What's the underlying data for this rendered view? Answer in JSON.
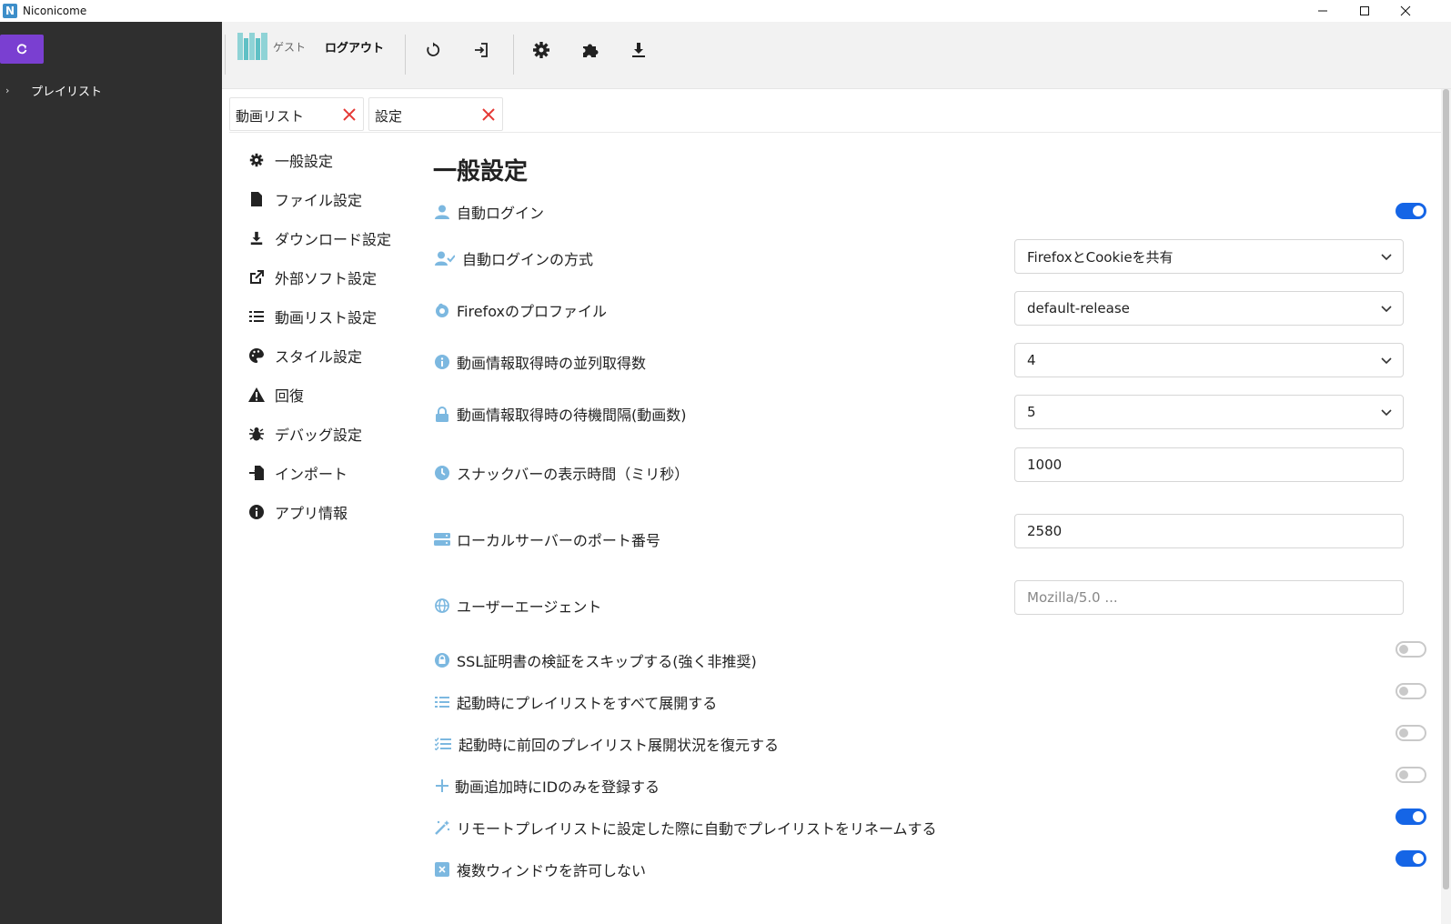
{
  "window": {
    "title": "Niconicome",
    "icon_letter": "N"
  },
  "sidebar": {
    "tree": [
      {
        "label": "プレイリスト"
      }
    ]
  },
  "toolbar": {
    "guest_label": "ゲスト",
    "logout_label": "ログアウト"
  },
  "tabs": [
    {
      "label": "動画リスト"
    },
    {
      "label": "設定"
    }
  ],
  "settings_nav": [
    {
      "label": "一般設定",
      "icon": "gear-icon"
    },
    {
      "label": "ファイル設定",
      "icon": "file-icon"
    },
    {
      "label": "ダウンロード設定",
      "icon": "download-icon"
    },
    {
      "label": "外部ソフト設定",
      "icon": "external-link-icon"
    },
    {
      "label": "動画リスト設定",
      "icon": "list-icon"
    },
    {
      "label": "スタイル設定",
      "icon": "palette-icon"
    },
    {
      "label": "回復",
      "icon": "warning-icon"
    },
    {
      "label": "デバッグ設定",
      "icon": "bug-icon"
    },
    {
      "label": "インポート",
      "icon": "import-icon"
    },
    {
      "label": "アプリ情報",
      "icon": "info-icon"
    }
  ],
  "general": {
    "heading": "一般設定",
    "auto_login": {
      "label": "自動ログイン",
      "checked": true
    },
    "login_method": {
      "label": "自動ログインの方式",
      "value": "FirefoxとCookieを共有"
    },
    "firefox_profile": {
      "label": "Firefoxのプロファイル",
      "value": "default-release"
    },
    "parallel": {
      "label": "動画情報取得時の並列取得数",
      "value": "4"
    },
    "wait_interval": {
      "label": "動画情報取得時の待機間隔(動画数)",
      "value": "5"
    },
    "snackbar": {
      "label": "スナックバーの表示時間（ミリ秒）",
      "value": "1000"
    },
    "port": {
      "label": "ローカルサーバーのポート番号",
      "value": "2580"
    },
    "user_agent": {
      "label": "ユーザーエージェント",
      "placeholder": "Mozilla/5.0 ..."
    },
    "skip_ssl": {
      "label": "SSL証明書の検証をスキップする(強く非推奨)",
      "checked": false
    },
    "expand_all": {
      "label": "起動時にプレイリストをすべて展開する",
      "checked": false
    },
    "restore_expand": {
      "label": "起動時に前回のプレイリスト展開状況を復元する",
      "checked": false
    },
    "id_only": {
      "label": "動画追加時にIDのみを登録する",
      "checked": false
    },
    "auto_rename": {
      "label": "リモートプレイリストに設定した際に自動でプレイリストをリネームする",
      "checked": true
    },
    "single_window": {
      "label": "複数ウィンドウを許可しない",
      "checked": true
    }
  },
  "colors": {
    "accent": "#1565e6",
    "sidebar_bg": "#2f2f2f",
    "refresh_btn": "#7a3fd1",
    "icon_blue": "#7cb8e0",
    "close_red": "#e53935"
  }
}
